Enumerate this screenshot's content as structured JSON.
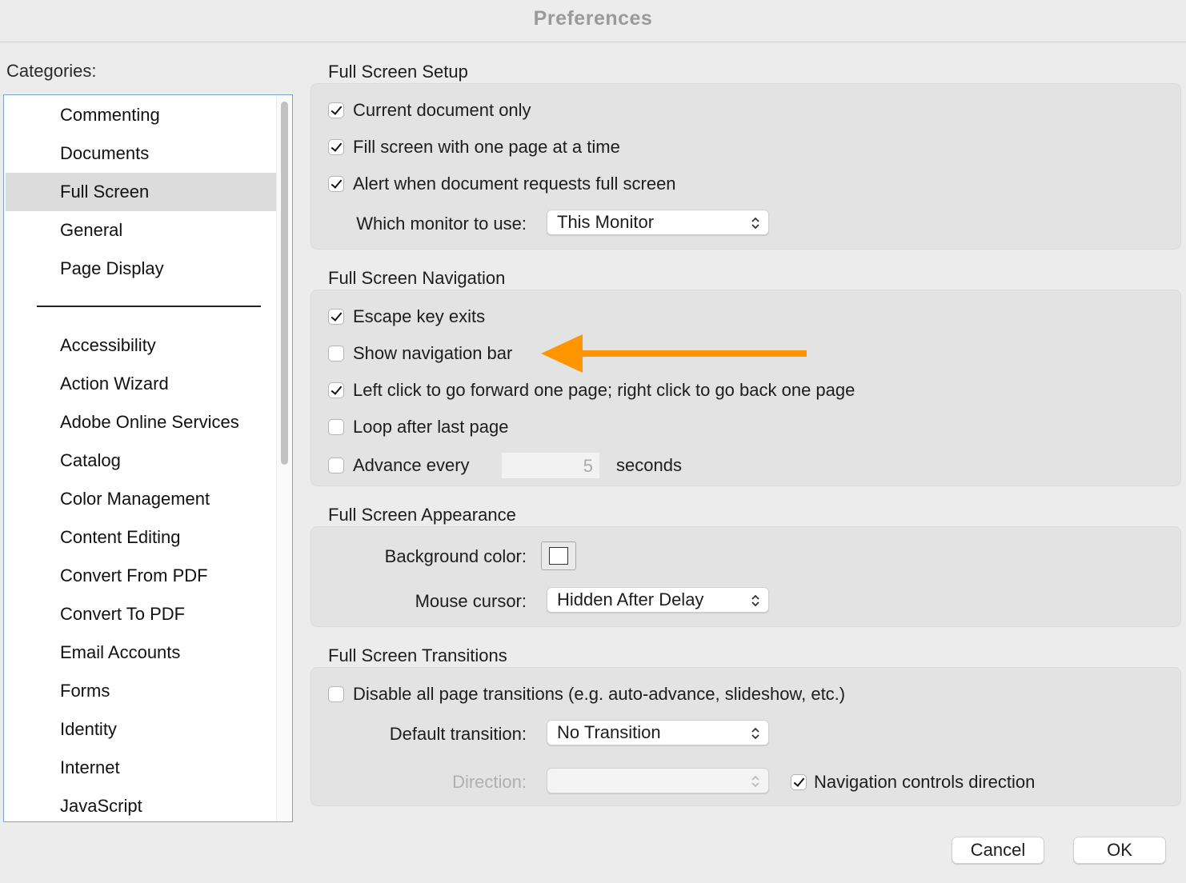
{
  "window": {
    "title": "Preferences"
  },
  "categories": {
    "label": "Categories:",
    "top_items": [
      "Commenting",
      "Documents",
      "Full Screen",
      "General",
      "Page Display"
    ],
    "items": [
      "Accessibility",
      "Action Wizard",
      "Adobe Online Services",
      "Catalog",
      "Color Management",
      "Content Editing",
      "Convert From PDF",
      "Convert To PDF",
      "Email Accounts",
      "Forms",
      "Identity",
      "Internet",
      "JavaScript"
    ],
    "selected": "Full Screen"
  },
  "setup": {
    "title": "Full Screen Setup",
    "current_doc": {
      "label": "Current document only",
      "checked": true
    },
    "fill_screen": {
      "label": "Fill screen with one page at a time",
      "checked": true
    },
    "alert": {
      "label": "Alert when document requests full screen",
      "checked": true
    },
    "monitor_label": "Which monitor to use:",
    "monitor_value": "This Monitor"
  },
  "navigation": {
    "title": "Full Screen Navigation",
    "escape": {
      "label": "Escape key exits",
      "checked": true
    },
    "nav_bar": {
      "label": "Show navigation bar",
      "checked": false
    },
    "left_click": {
      "label": "Left click to go forward one page; right click to go back one page",
      "checked": true
    },
    "loop": {
      "label": "Loop after last page",
      "checked": false
    },
    "advance": {
      "label": "Advance every",
      "checked": false,
      "value": "5",
      "suffix": "seconds"
    },
    "annotation_color": "#ff9500"
  },
  "appearance": {
    "title": "Full Screen Appearance",
    "bg_label": "Background color:",
    "bg_color": "#ffffff",
    "cursor_label": "Mouse cursor:",
    "cursor_value": "Hidden After Delay"
  },
  "transitions": {
    "title": "Full Screen Transitions",
    "disable": {
      "label": "Disable all page transitions (e.g. auto-advance, slideshow, etc.)",
      "checked": false
    },
    "default_label": "Default transition:",
    "default_value": "No Transition",
    "direction_label": "Direction:",
    "direction_value": "",
    "nav_dir": {
      "label": "Navigation controls direction",
      "checked": true
    }
  },
  "buttons": {
    "cancel": "Cancel",
    "ok": "OK"
  }
}
